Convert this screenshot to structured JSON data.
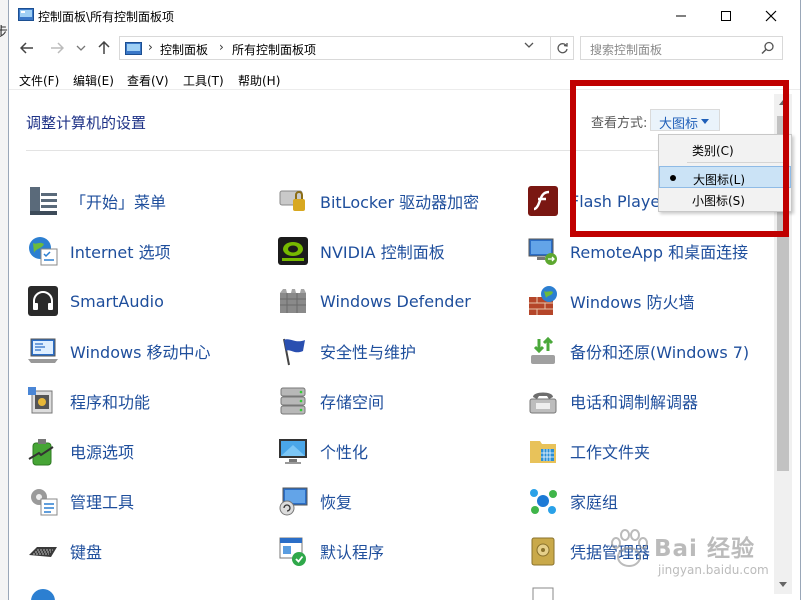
{
  "window": {
    "title": "控制面板\\所有控制面板项"
  },
  "address": {
    "crumbs": [
      "控制面板",
      "所有控制面板项"
    ],
    "separator": "›"
  },
  "search": {
    "placeholder": "搜索控制面板"
  },
  "menu": [
    "文件(F)",
    "编辑(E)",
    "查看(V)",
    "工具(T)",
    "帮助(H)"
  ],
  "content": {
    "heading": "调整计算机的设置",
    "view_by_label": "查看方式:",
    "view_by_value": "大图标"
  },
  "dropdown": {
    "options": [
      "类别(C)",
      "大图标(L)",
      "小图标(S)"
    ],
    "selected": "大图标(L)"
  },
  "items": [
    {
      "label": "「开始」菜单",
      "icon": "start-menu-icon"
    },
    {
      "label": "BitLocker 驱动器加密",
      "icon": "bitlocker-icon"
    },
    {
      "label": "Flash Player",
      "icon": "flash-player-icon"
    },
    {
      "label": "Internet 选项",
      "icon": "internet-options-icon"
    },
    {
      "label": "NVIDIA 控制面板",
      "icon": "nvidia-icon"
    },
    {
      "label": "RemoteApp 和桌面连接",
      "icon": "remoteapp-icon"
    },
    {
      "label": "SmartAudio",
      "icon": "smartaudio-icon"
    },
    {
      "label": "Windows Defender",
      "icon": "windows-defender-icon"
    },
    {
      "label": "Windows 防火墙",
      "icon": "firewall-icon"
    },
    {
      "label": "Windows 移动中心",
      "icon": "mobility-center-icon"
    },
    {
      "label": "安全性与维护",
      "icon": "security-flag-icon"
    },
    {
      "label": "备份和还原(Windows 7)",
      "icon": "backup-restore-icon"
    },
    {
      "label": "程序和功能",
      "icon": "programs-features-icon"
    },
    {
      "label": "存储空间",
      "icon": "storage-spaces-icon"
    },
    {
      "label": "电话和调制解调器",
      "icon": "phone-modem-icon"
    },
    {
      "label": "电源选项",
      "icon": "power-options-icon"
    },
    {
      "label": "个性化",
      "icon": "personalization-icon"
    },
    {
      "label": "工作文件夹",
      "icon": "work-folders-icon"
    },
    {
      "label": "管理工具",
      "icon": "admin-tools-icon"
    },
    {
      "label": "恢复",
      "icon": "recovery-icon"
    },
    {
      "label": "家庭组",
      "icon": "homegroup-icon"
    },
    {
      "label": "键盘",
      "icon": "keyboard-icon"
    },
    {
      "label": "默认程序",
      "icon": "default-programs-icon"
    },
    {
      "label": "凭据管理器",
      "icon": "credential-manager-icon"
    }
  ],
  "watermark": {
    "text": "Bai 经验",
    "sub": "jingyan.baidu.com"
  },
  "colors": {
    "accent": "#1e4e9c",
    "heading": "#1e3287",
    "annotation": "#c00000",
    "highlight": "#cbe3f6"
  }
}
